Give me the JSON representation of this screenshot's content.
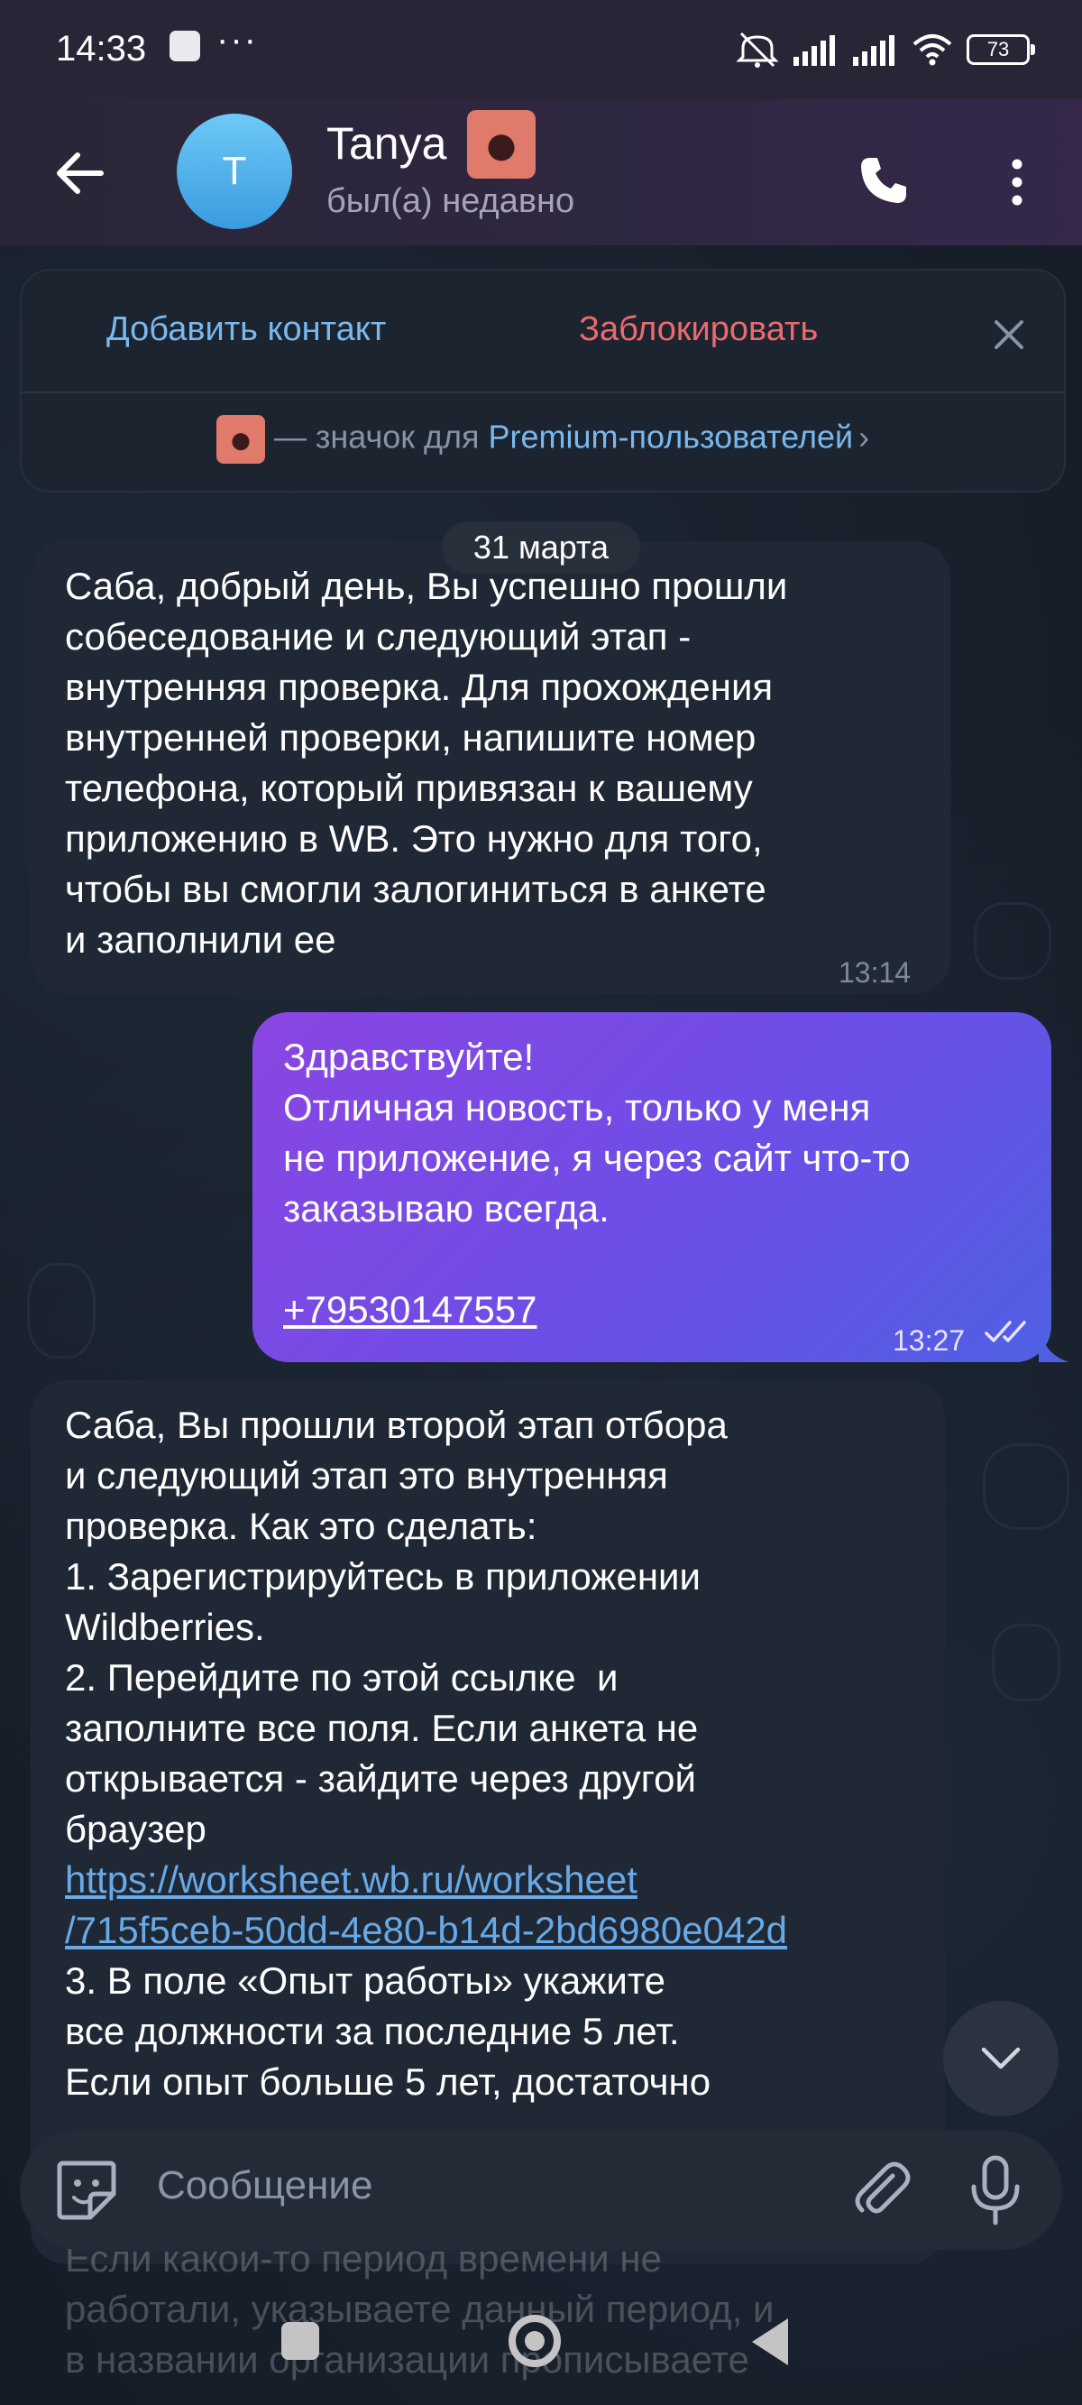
{
  "status_bar": {
    "time": "14:33",
    "dots": "···",
    "battery": "73"
  },
  "header": {
    "avatar_letter": "T",
    "name": "Tanya",
    "status": "был(а) недавно"
  },
  "action_panel": {
    "add_contact": "Добавить контакт",
    "block": "Заблокировать",
    "premium_prefix": "— значок для ",
    "premium_link": "Premium-пользователей",
    "premium_chevron": "›"
  },
  "date_pill": "31 марта",
  "messages": [
    {
      "direction": "incoming",
      "lines": [
        "Саба, добрый день, Вы успешно прошли",
        "собеседование и следующий этап -",
        "внутренняя проверка. Для прохождения",
        "внутренней проверки, напишите номер",
        "телефона, который привязан к вашему",
        "приложению в WB. Это нужно для того,",
        "чтобы вы смогли залогиниться в анкете",
        "и заполнили ее"
      ],
      "time": "13:14"
    },
    {
      "direction": "outgoing",
      "lines": [
        "Здравствуйте!",
        "Отличная новость, только у меня",
        "не приложение, я через сайт что-то",
        "заказываю всегда."
      ],
      "phone": "+79530147557",
      "time": "13:27",
      "read_status": "read"
    },
    {
      "direction": "incoming",
      "lines_before_link": [
        "Саба, Вы прошли второй этап отбора",
        "и следующий этап это внутренняя",
        "проверка. Как это сделать:",
        "1. Зарегистрируйтесь в приложении",
        "Wildberries.",
        "2. Перейдите по этой ссылке  и",
        "заполните все поля. Если анкета не",
        "открывается - зайдите через другой",
        "браузер"
      ],
      "link_lines": [
        "https://worksheet.wb.ru/worksheet",
        "/715f5ceb-50dd-4e80-b14d-2bd6980e042d"
      ],
      "lines_after_link": [
        "3. В поле «Опыт работы» укажите",
        "все должности за последние 5 лет.",
        "Если опыт больше 5 лет, достаточно"
      ]
    }
  ],
  "hidden_under_composer": [
    "Если какой-то период времени не",
    "работали, указываете данный период, и",
    "в названии организации прописываете"
  ],
  "composer": {
    "placeholder": "Сообщение"
  },
  "colors": {
    "accent_link": "#79b8ee",
    "danger": "#ec6a6e",
    "outgoing_bubble_start": "#8b45e2",
    "outgoing_bubble_end": "#4f60e4",
    "incoming_bubble": "#1f2834"
  }
}
